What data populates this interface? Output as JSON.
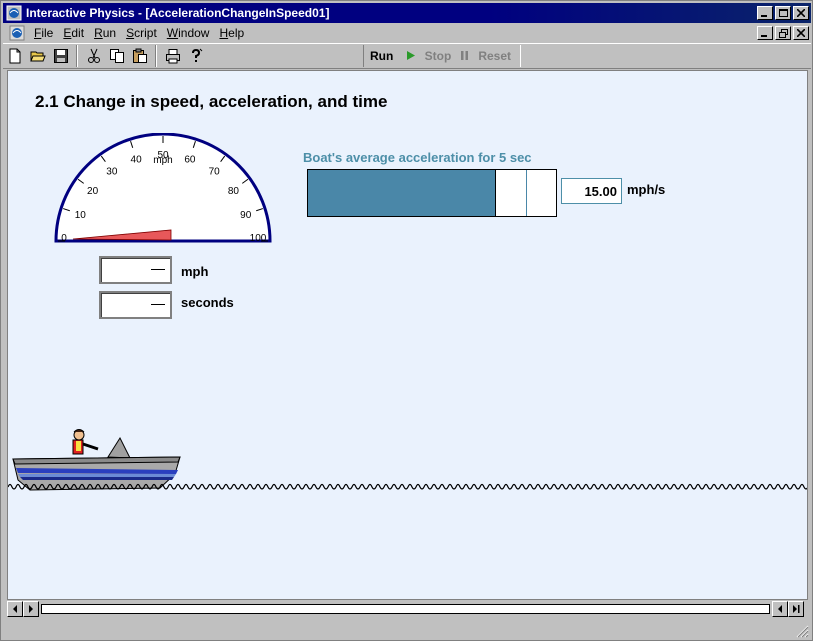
{
  "window": {
    "title": "Interactive Physics - [AccelerationChangeInSpeed01]"
  },
  "menu": [
    {
      "u": "F",
      "rest": "ile"
    },
    {
      "u": "E",
      "rest": "dit"
    },
    {
      "u": "R",
      "rest": "un"
    },
    {
      "u": "S",
      "rest": "cript"
    },
    {
      "u": "W",
      "rest": "indow"
    },
    {
      "u": "H",
      "rest": "elp"
    }
  ],
  "toolbar": {
    "run": "Run",
    "stop": "Stop",
    "reset": "Reset"
  },
  "sim": {
    "heading": "2.1 Change in speed, acceleration, and time",
    "speedometer": {
      "unit_label": "mph",
      "ticks": [
        "0",
        "10",
        "20",
        "30",
        "40",
        "50",
        "60",
        "70",
        "80",
        "90",
        "100"
      ],
      "min": 0,
      "max": 100,
      "needle_value": 0
    },
    "speed_display": {
      "value": "",
      "unit": "mph"
    },
    "time_display": {
      "value": "",
      "unit": "seconds"
    },
    "accel_bar": {
      "title": "Boat's average acceleration for 5 sec",
      "fill_fraction": 0.76,
      "marker_fraction": 0.88,
      "value": "15.00",
      "unit": "mph/s"
    }
  },
  "colors": {
    "bar_fill": "#4a87a8",
    "title_blue": "#4d8fa8",
    "gauge_ring": "#000080",
    "needle": "#e8585a"
  }
}
